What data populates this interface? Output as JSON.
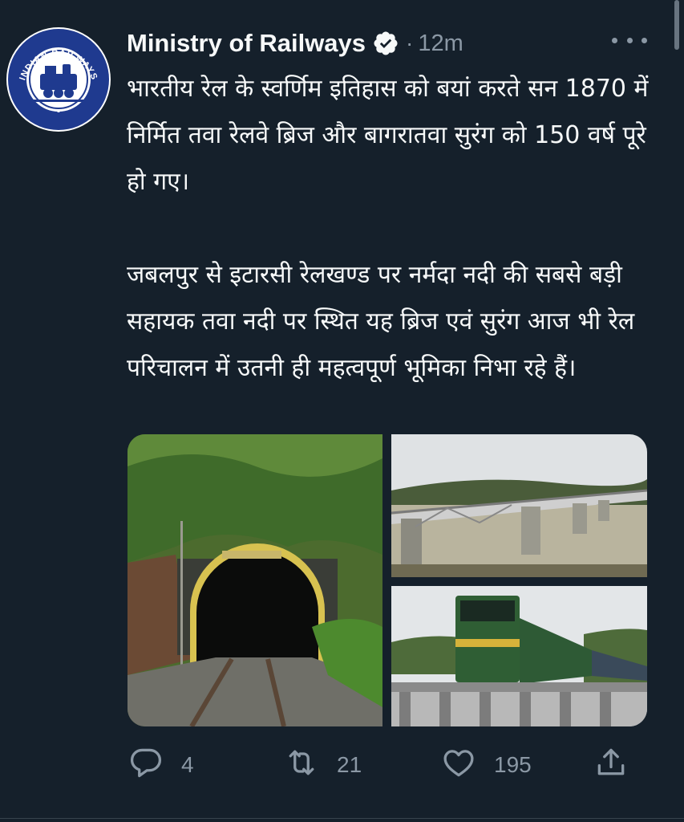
{
  "tweet": {
    "author": {
      "name": "Ministry of Railways",
      "verified": true,
      "logo_text": "INDIAN RAILWAYS",
      "logo_text_hindi": "भारतीय रेल"
    },
    "separator": "·",
    "time": "12m",
    "paragraphs": [
      "भारतीय रेल के स्वर्णिम इतिहास को बयां करते सन 1870 में निर्मित तवा रेलवे ब्रिज और बागरातवा सुरंग को 150 वर्ष पूरे हो गए।",
      "जबलपुर से इटारसी रेलखण्ड पर नर्मदा नदी की सबसे बड़ी सहायक तवा नदी पर स्थित यह ब्रिज एवं सुरंग आज भी रेल परिचालन में उतनी ही महत्वपूर्ण भूमिका निभा रहे हैं।"
    ],
    "media": [
      "railway-tunnel-photo",
      "tawa-bridge-photo",
      "train-on-bridge-photo"
    ],
    "stats": {
      "replies": "4",
      "retweets": "21",
      "likes": "195"
    }
  },
  "colors": {
    "background": "#15202b",
    "text": "#f7f9f9",
    "muted": "#8b98a5",
    "logo_blue": "#1f3a8f"
  },
  "icons": [
    "verified-badge-icon",
    "more-options-icon",
    "reply-icon",
    "retweet-icon",
    "like-icon",
    "share-icon"
  ]
}
